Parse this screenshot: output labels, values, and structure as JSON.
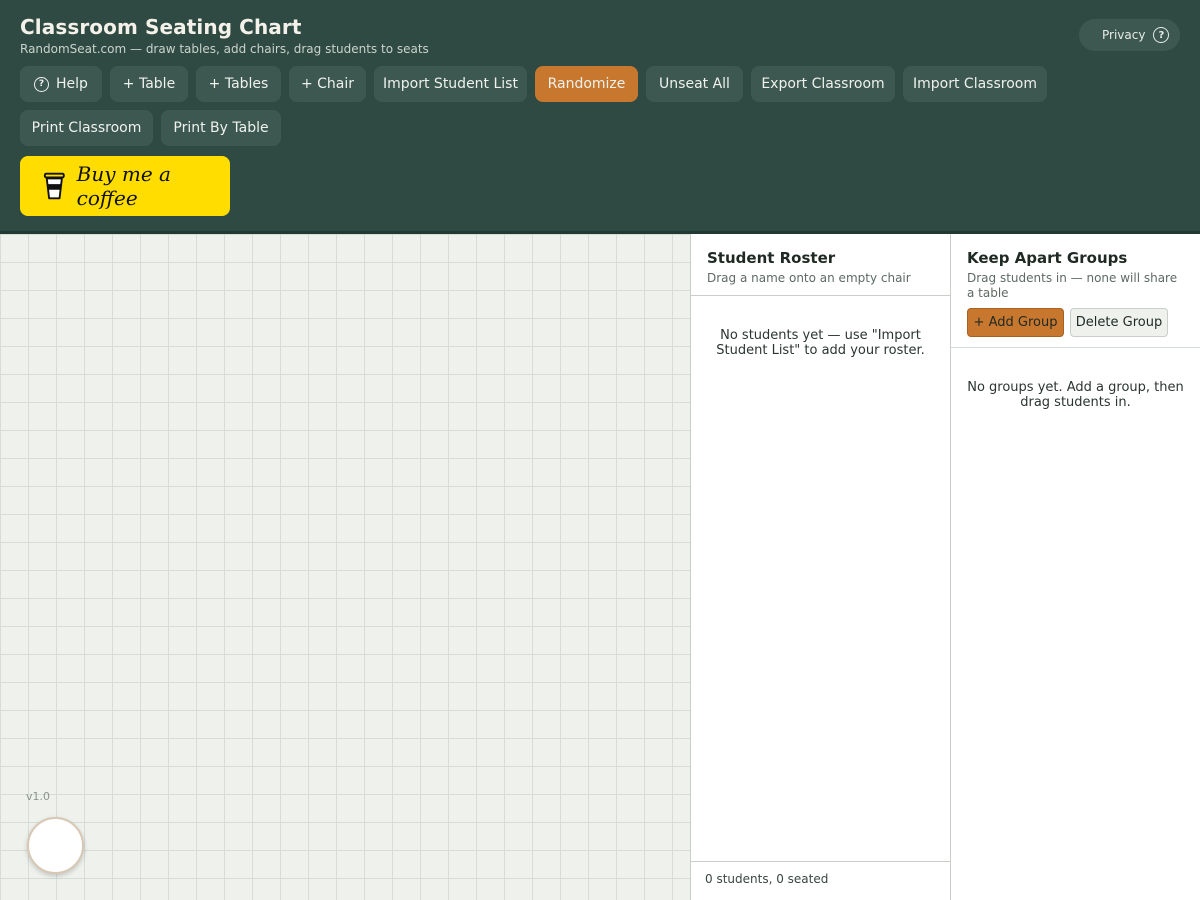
{
  "header": {
    "title": "Classroom Seating Chart",
    "subtitle": "RandomSeat.com — draw tables, add chairs, drag students to seats",
    "privacy_label": "Privacy",
    "privacy_icon": "question-circle-icon",
    "accent_color": "#c8772f",
    "background_color": "#2f4a42"
  },
  "toolbar": {
    "help": "Help",
    "add_table": "+ Table",
    "add_tables": "+ Tables",
    "add_chair": "+ Chair",
    "import_student_list": "Import Student List",
    "randomize": "Randomize",
    "unseat_all": "Unseat All",
    "export_classroom": "Export Classroom",
    "import_classroom": "Import Classroom",
    "print_classroom": "Print Classroom",
    "print_by_table": "Print By Table",
    "buy_me_coffee": "Buy me a coffee",
    "coffee_color": "#ffdd00"
  },
  "canvas": {
    "version": "v1.0"
  },
  "roster": {
    "title": "Student Roster",
    "subtitle": "Drag a name onto an empty chair",
    "empty_message": "No students yet — use \"Import Student List\" to add your roster.",
    "footer": "0 students, 0 seated"
  },
  "groups": {
    "title": "Keep Apart Groups",
    "subtitle": "Drag students in — none will share a table",
    "add_group": "+ Add Group",
    "delete_group": "Delete Group",
    "empty_message": "No groups yet. Add a group, then drag students in."
  }
}
